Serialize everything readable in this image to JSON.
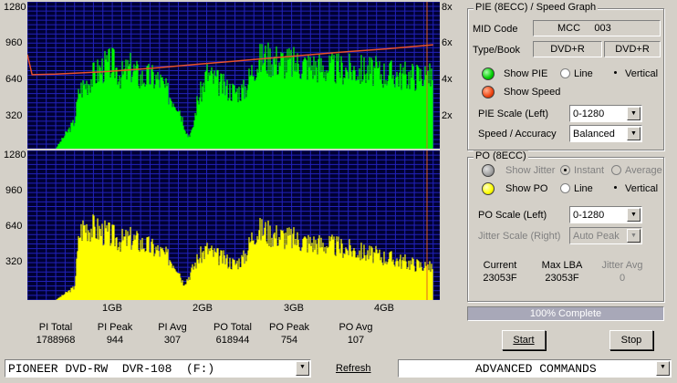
{
  "top_chart": {
    "left_ticks": [
      "1280",
      "960",
      "640",
      "320"
    ],
    "right_ticks": [
      "8x",
      "6x",
      "4x",
      "2x"
    ]
  },
  "bottom_chart": {
    "left_ticks": [
      "1280",
      "960",
      "640",
      "320"
    ],
    "x_ticks": [
      "1GB",
      "2GB",
      "3GB",
      "4GB"
    ]
  },
  "chart_data": [
    {
      "type": "area",
      "series": [
        {
          "color": "#00ff00",
          "x": [
            0.3,
            0.5,
            0.55,
            0.7,
            0.8,
            0.9,
            1.0,
            1.1,
            1.2,
            1.3,
            1.4,
            1.5,
            1.6,
            1.7,
            1.75,
            1.8,
            1.85,
            1.9,
            2.0,
            2.1,
            2.2,
            2.3,
            2.4,
            2.5,
            2.6,
            2.8,
            3.0,
            3.2,
            3.4,
            3.6,
            3.8,
            4.0,
            4.2,
            4.3
          ],
          "values": [
            0,
            260,
            560,
            700,
            780,
            820,
            700,
            780,
            680,
            690,
            660,
            520,
            420,
            120,
            170,
            450,
            560,
            720,
            650,
            580,
            550,
            560,
            790,
            880,
            860,
            820,
            800,
            770,
            760,
            750,
            720,
            700,
            700,
            680
          ]
        },
        {
          "color": "#e8502a",
          "x": [
            0.0,
            0.05,
            0.3,
            0.8,
            1.3,
            1.8,
            2.3,
            2.8,
            3.3,
            3.8,
            4.3
          ],
          "values": [
            820,
            645,
            650,
            670,
            700,
            735,
            770,
            805,
            840,
            870,
            905
          ]
        }
      ],
      "ylim": [
        0,
        1280
      ]
    },
    {
      "type": "area",
      "series": [
        {
          "color": "#ffff00",
          "x": [
            0.3,
            0.5,
            0.55,
            0.6,
            0.7,
            0.8,
            0.9,
            1.0,
            1.1,
            1.2,
            1.3,
            1.4,
            1.5,
            1.6,
            1.65,
            1.7,
            1.8,
            1.9,
            2.0,
            2.1,
            2.2,
            2.3,
            2.4,
            2.5,
            2.6,
            2.8,
            3.0,
            3.2,
            3.4,
            3.6,
            3.8,
            4.0,
            4.2,
            4.3
          ],
          "values": [
            0,
            120,
            620,
            700,
            680,
            640,
            600,
            560,
            580,
            540,
            500,
            460,
            400,
            300,
            160,
            200,
            380,
            480,
            420,
            380,
            340,
            400,
            640,
            660,
            620,
            580,
            540,
            520,
            480,
            440,
            400,
            360,
            320,
            300
          ]
        }
      ],
      "ylim": [
        0,
        1280
      ]
    }
  ],
  "stats": [
    {
      "label": "PI Total",
      "value": "1788968"
    },
    {
      "label": "PI Peak",
      "value": "944"
    },
    {
      "label": "PI Avg",
      "value": "307"
    },
    {
      "label": "PO Total",
      "value": "618944"
    },
    {
      "label": "PO Peak",
      "value": "754"
    },
    {
      "label": "PO Avg",
      "value": "107"
    }
  ],
  "pie_group": {
    "title": "PIE (8ECC) / Speed Graph",
    "mid_code_label": "MID Code",
    "mid_code_value": "MCC     003",
    "type_book_label": "Type/Book",
    "type_value": "DVD+R",
    "book_value": "DVD+R",
    "show_pie": "Show PIE",
    "show_speed": "Show Speed",
    "line": "Line",
    "vertical": "Vertical",
    "pie_scale_label": "PIE Scale (Left)",
    "pie_scale_value": "0-1280",
    "speed_label": "Speed / Accuracy",
    "speed_value": "Balanced",
    "pie_color": "#00cc00",
    "speed_color": "#ee4411"
  },
  "po_group": {
    "title": "PO (8ECC)",
    "show_jitter": "Show Jitter",
    "instant": "Instant",
    "average": "Average",
    "show_po": "Show PO",
    "line": "Line",
    "vertical": "Vertical",
    "po_scale_label": "PO Scale (Left)",
    "po_scale_value": "0-1280",
    "jitter_scale_label": "Jitter Scale (Right)",
    "jitter_scale_value": "Auto Peak",
    "current_label": "Current",
    "current_value": "23053F",
    "maxlba_label": "Max LBA",
    "maxlba_value": "23053F",
    "jitter_avg_label": "Jitter Avg",
    "jitter_avg_value": "0",
    "po_color": "#ffff00",
    "jitter_color": "#909090"
  },
  "progress": {
    "text": "100% Complete",
    "fraction": 1.0
  },
  "buttons": {
    "start": "Start",
    "stop": "Stop",
    "refresh": "Refresh"
  },
  "drive_select": "PIONEER DVD-RW  DVR-108  (F:)",
  "commands_select": "ADVANCED COMMANDS"
}
